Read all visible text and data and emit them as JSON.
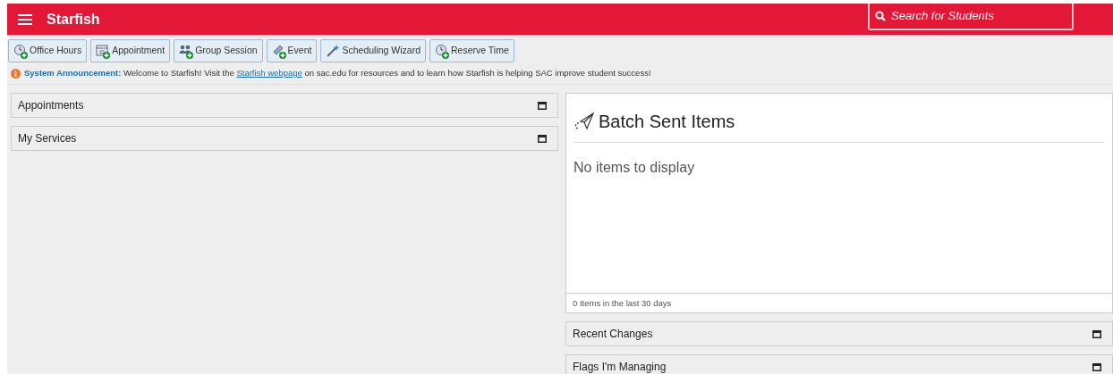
{
  "header": {
    "title": "Starfish",
    "search": {
      "placeholder": "Search for Students"
    }
  },
  "toolbar": [
    "Office Hours",
    "Appointment",
    "Group Session",
    "Event",
    "Scheduling Wizard",
    "Reserve Time"
  ],
  "announcement": {
    "label": "System Announcement:",
    "text_before": "Welcome to Starfish! Visit the",
    "link": "Starfish webpage",
    "text_after": "on sac.edu for resources and to learn how Starfish is helping SAC improve student success!"
  },
  "left_panels": [
    {
      "title": "Appointments"
    },
    {
      "title": "My Services"
    }
  ],
  "batch_sent": {
    "title": "Batch Sent Items",
    "empty_text": "No items to display",
    "footer": "0 Items in the last 30 days"
  },
  "right_panels": [
    {
      "title": "Recent Changes"
    },
    {
      "title": "Flags I'm Managing"
    }
  ]
}
